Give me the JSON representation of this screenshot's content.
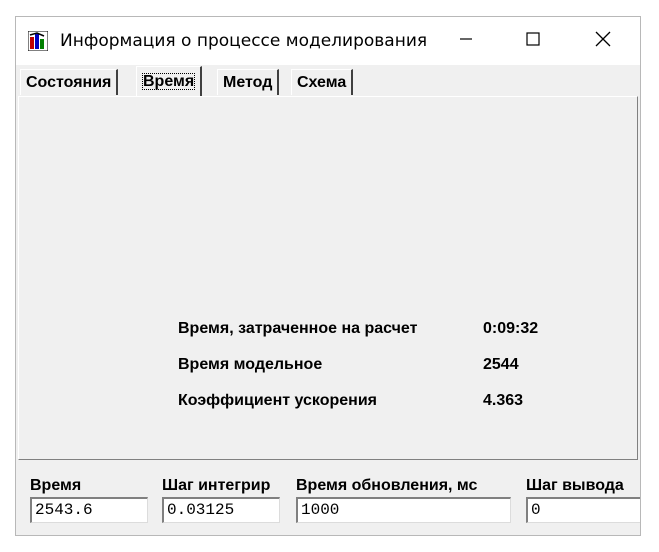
{
  "window": {
    "title": "Информация о процессе моделирования",
    "icon": "app-model-icon"
  },
  "tabs": [
    {
      "label": "Состояния"
    },
    {
      "label": "Время"
    },
    {
      "label": "Метод"
    },
    {
      "label": "Схема"
    }
  ],
  "active_tab": "Время",
  "info": {
    "calc_time_label": "Время, затраченное на расчет",
    "calc_time_value": "0:09:32",
    "model_time_label": "Время модельное",
    "model_time_value": "2544",
    "speedup_label": "Коэффициент ускорения",
    "speedup_value": "4.363"
  },
  "fields": {
    "time_label": "Время",
    "time_value": "2543.6",
    "step_label": "Шаг интегрир",
    "step_value": "0.03125",
    "refresh_label": "Время обновления, мс",
    "refresh_value": "1000",
    "output_label": "Шаг вывода",
    "output_value": "0"
  }
}
